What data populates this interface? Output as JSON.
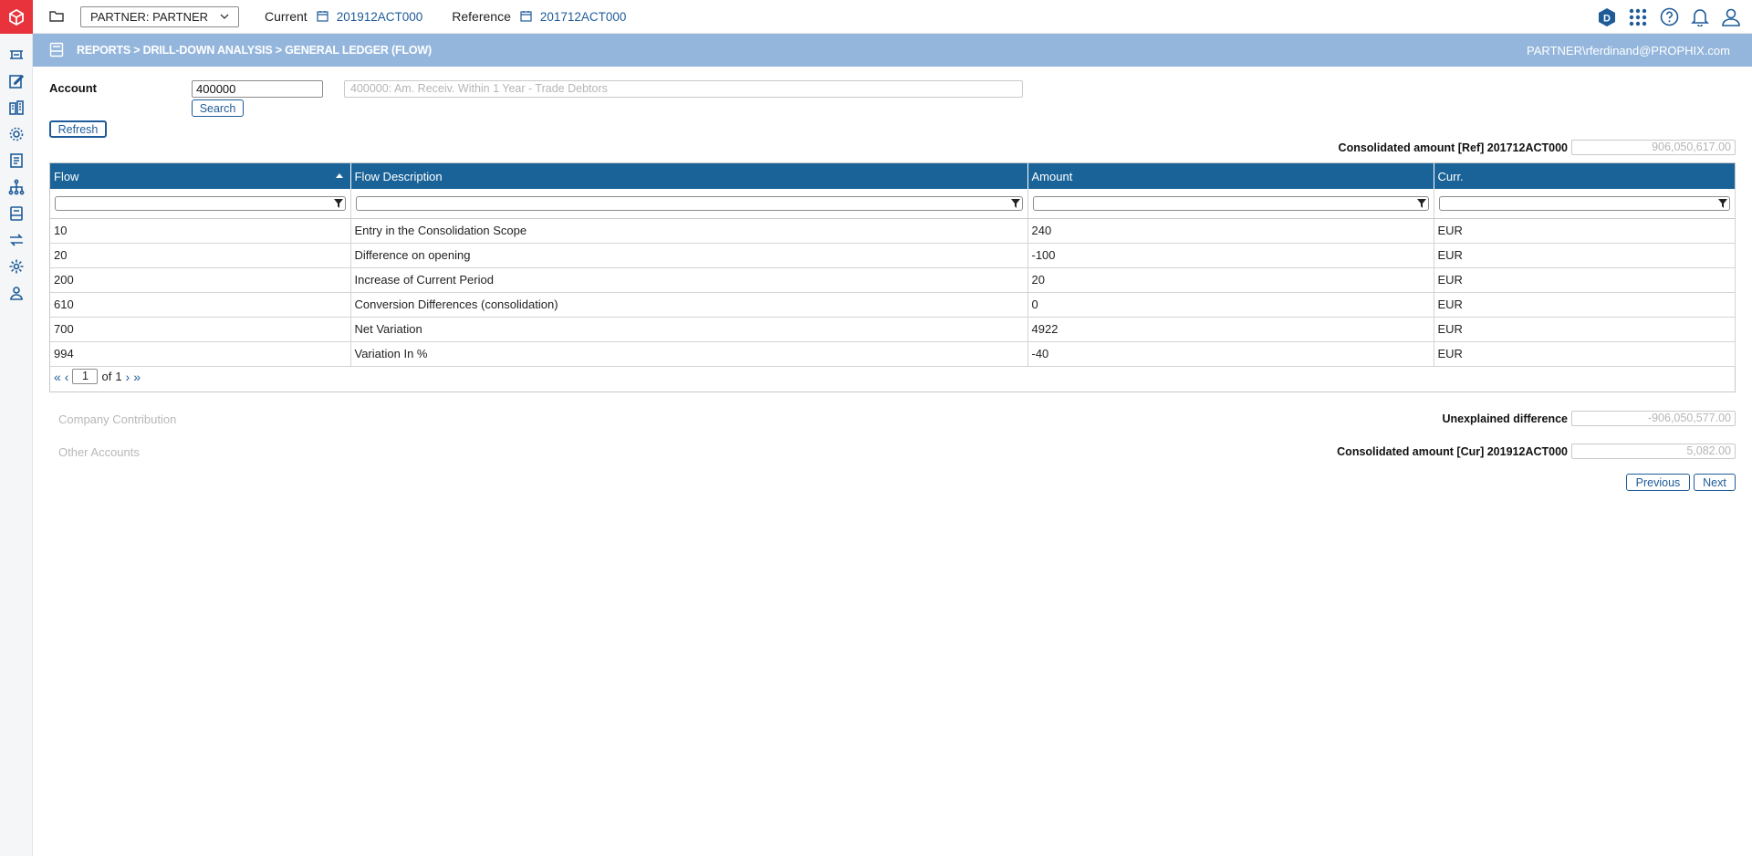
{
  "topbar": {
    "partner_select": "PARTNER: PARTNER",
    "current_label": "Current",
    "current_value": "201912ACT000",
    "reference_label": "Reference",
    "reference_value": "201712ACT000",
    "badge_letter": "D"
  },
  "band": {
    "breadcrumb": "REPORTS > DRILL-DOWN ANALYSIS > GENERAL LEDGER (FLOW)",
    "user": "PARTNER\\rferdinand@PROPHIX.com"
  },
  "form": {
    "account_label": "Account",
    "account_value": "400000",
    "account_description": "400000: Am. Receiv. Within 1 Year - Trade Debtors",
    "search_label": "Search",
    "refresh_label": "Refresh"
  },
  "summary": {
    "consolidated_ref_label": "Consolidated amount [Ref] 201712ACT000",
    "consolidated_ref_value": "906,050,617.00",
    "unexplained_label": "Unexplained difference",
    "unexplained_value": "-906,050,577.00",
    "consolidated_cur_label": "Consolidated amount [Cur] 201912ACT000",
    "consolidated_cur_value": "5,082.00"
  },
  "grid": {
    "columns": [
      "Flow",
      "Flow Description",
      "Amount",
      "Curr."
    ],
    "rows": [
      [
        "10",
        "Entry in the Consolidation Scope",
        "240",
        "EUR"
      ],
      [
        "20",
        "Difference on opening",
        "-100",
        "EUR"
      ],
      [
        "200",
        "Increase of Current Period",
        "20",
        "EUR"
      ],
      [
        "610",
        "Conversion Differences (consolidation)",
        "0",
        "EUR"
      ],
      [
        "700",
        "Net Variation",
        "4922",
        "EUR"
      ],
      [
        "994",
        "Variation In %",
        "-40",
        "EUR"
      ]
    ]
  },
  "pager": {
    "page": "1",
    "of_label": "of",
    "total": "1"
  },
  "side_links": {
    "company_contribution": "Company Contribution",
    "other_accounts": "Other Accounts"
  },
  "nav": {
    "previous": "Previous",
    "next": "Next"
  },
  "colors": {
    "brand_red": "#e8323c",
    "band_blue": "#94b6dc",
    "header_blue": "#1a6398",
    "link_blue": "#1e5b99"
  }
}
